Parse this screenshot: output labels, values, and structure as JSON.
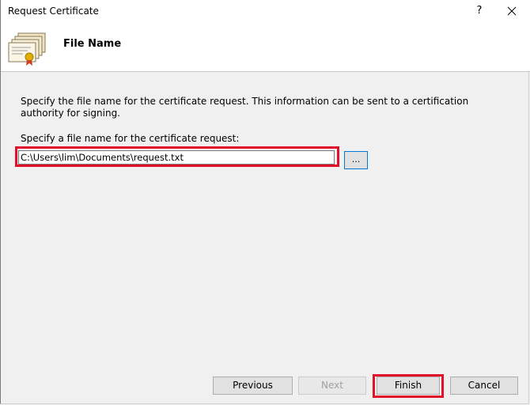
{
  "window": {
    "title": "Request Certificate",
    "help_label": "?",
    "close_icon": "close-icon"
  },
  "header": {
    "icon": "certificate-icon",
    "heading": "File Name"
  },
  "content": {
    "description": "Specify the file name for the certificate request. This information can be sent to a certification authority for signing.",
    "field_label": "Specify a file name for the certificate request:",
    "filename_value": "C:\\Users\\lim\\Documents\\request.txt",
    "browse_label": "..."
  },
  "footer": {
    "previous_label": "Previous",
    "next_label": "Next",
    "finish_label": "Finish",
    "cancel_label": "Cancel"
  },
  "colors": {
    "highlight": "#e3102a",
    "focus_border": "#0078d7"
  }
}
